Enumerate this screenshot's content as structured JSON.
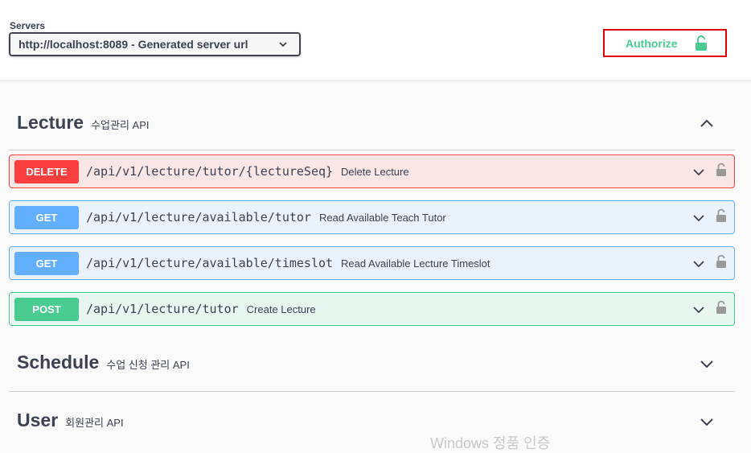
{
  "servers": {
    "label": "Servers",
    "selected": "http://localhost:8089 - Generated server url"
  },
  "authorize": {
    "label": "Authorize",
    "icon": "unlock-icon",
    "color": "#49cc90"
  },
  "tags": [
    {
      "name": "Lecture",
      "description": "수업관리 API",
      "expanded": true,
      "operations": [
        {
          "method": "DELETE",
          "path": "/api/v1/lecture/tutor/{lectureSeq}",
          "summary": "Delete Lecture"
        },
        {
          "method": "GET",
          "path": "/api/v1/lecture/available/tutor",
          "summary": "Read Available Teach Tutor"
        },
        {
          "method": "GET",
          "path": "/api/v1/lecture/available/timeslot",
          "summary": "Read Available Lecture Timeslot"
        },
        {
          "method": "POST",
          "path": "/api/v1/lecture/tutor",
          "summary": "Create Lecture"
        }
      ]
    },
    {
      "name": "Schedule",
      "description": "수업 신청 관리 API",
      "expanded": false
    },
    {
      "name": "User",
      "description": "회원관리 API",
      "expanded": false
    }
  ],
  "colors": {
    "delete": "#f93e3e",
    "get": "#61affe",
    "post": "#49cc90"
  },
  "watermark": "Windows 정품 인증"
}
